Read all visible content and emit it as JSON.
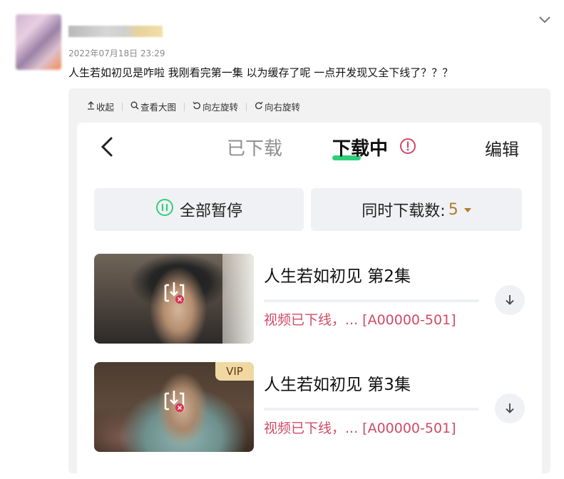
{
  "post": {
    "timestamp": "2022年07月18日 23:29",
    "text": "人生若如初见是咋啦 我刚看完第一集 以为缓存了呢 一点开发现又全下线了？？？"
  },
  "icons": {
    "collapse": "chevron-down-icon",
    "back": "chevron-left-icon",
    "alert": "exclamation-circle-icon",
    "pause": "pause-circle-icon",
    "download": "download-arrow-icon",
    "offline": "offline-download-icon"
  },
  "toolbar": {
    "collapse_label": "收起",
    "view_large_label": "查看大图",
    "rotate_left_label": "向左旋转",
    "rotate_right_label": "向右旋转"
  },
  "app": {
    "tab_downloaded": "已下载",
    "tab_downloading": "下载中",
    "edit_label": "编辑",
    "pause_all_label": "全部暂停",
    "concurrent_label": "同时下载数:",
    "concurrent_value": "5",
    "episodes": [
      {
        "title": "人生若如初见 第2集",
        "status": "视频已下线，... [A00000-501]",
        "badge": ""
      },
      {
        "title": "人生若如初见 第3集",
        "status": "视频已下线，... [A00000-501]",
        "badge": "VIP"
      }
    ]
  },
  "colors": {
    "accent_green": "#2fd07a",
    "alert_red": "#d0486a",
    "status_red": "#d04a66",
    "concurrent_gold": "#b07a2e",
    "vip_bg": "#f1d8a3"
  }
}
